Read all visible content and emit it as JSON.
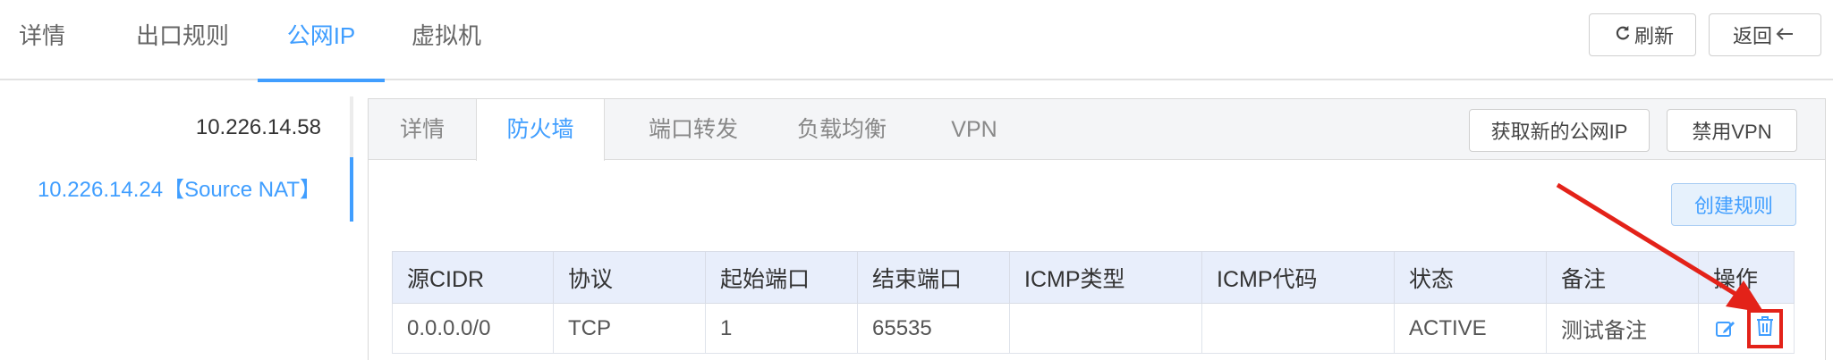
{
  "top_tabs": [
    {
      "label": "详情"
    },
    {
      "label": "出口规则"
    },
    {
      "label": "公网IP"
    },
    {
      "label": "虚拟机"
    }
  ],
  "toolbar": {
    "refresh_label": "刷新",
    "back_label": "返回"
  },
  "ip_list": [
    {
      "label": "10.226.14.58"
    },
    {
      "label": "10.226.14.24【Source NAT】"
    }
  ],
  "sub_tabs": [
    {
      "label": "详情"
    },
    {
      "label": "防火墙"
    },
    {
      "label": "端口转发"
    },
    {
      "label": "负载均衡"
    },
    {
      "label": "VPN"
    }
  ],
  "panel_actions": {
    "acquire_ip_label": "获取新的公网IP",
    "disable_vpn_label": "禁用VPN",
    "create_rule_label": "创建规则"
  },
  "firewall_table": {
    "columns": [
      "源CIDR",
      "协议",
      "起始端口",
      "结束端口",
      "ICMP类型",
      "ICMP代码",
      "状态",
      "备注",
      "操作"
    ],
    "rows": [
      {
        "cidr": "0.0.0.0/0",
        "protocol": "TCP",
        "start_port": "1",
        "end_port": "65535",
        "icmp_type": "",
        "icmp_code": "",
        "status": "ACTIVE",
        "remark": "测试备注"
      }
    ]
  },
  "colors": {
    "accent": "#409eff",
    "highlight": "#e32219"
  },
  "icons": {
    "refresh": "refresh-icon",
    "back": "arrow-left-icon",
    "edit": "edit-icon",
    "delete": "trash-icon"
  }
}
